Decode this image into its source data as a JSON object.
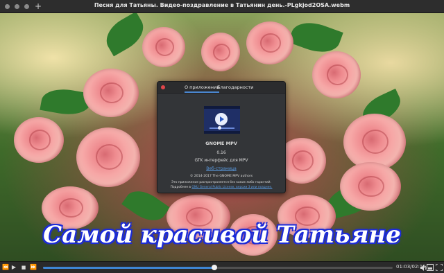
{
  "window": {
    "title": "Песня для Татьяны. Видео-поздравление в Татьянин день.-PLgkjod2OSA.webm",
    "add_tab": "+"
  },
  "video": {
    "caption": "Самой красивой Татьяне"
  },
  "about_dialog": {
    "tabs": [
      {
        "label": "О приложении",
        "active": true
      },
      {
        "label": "Благодарности",
        "active": false
      }
    ],
    "icon": "gnome-mpv-app-icon",
    "app_name": "GNOME MPV",
    "version": "0.16",
    "comment": "GTK интерфейс для MPV",
    "website_label": "Веб-страница",
    "copyright": "© 2014-2017 The GNOME MPV authors",
    "license_line1": "Это приложение распространяется без каких-либо гарантий.",
    "license_prefix": "Подробнее в ",
    "license_link": "GNU General Public License, версии 3 или позднее."
  },
  "controls": {
    "rewind_icon": "⏪",
    "play_icon": "▶",
    "stop_icon": "■",
    "forward_icon": "⏩",
    "progress": 0.49,
    "time": "01:03/02:13",
    "volume_icon": "speaker-icon",
    "playlist_icon": "playlist-icon",
    "fullscreen_icon": "fullscreen-icon"
  },
  "colors": {
    "accent": "#3e85d3",
    "close_button": "#e0464a",
    "caption_outline": "#1b2bd8"
  }
}
